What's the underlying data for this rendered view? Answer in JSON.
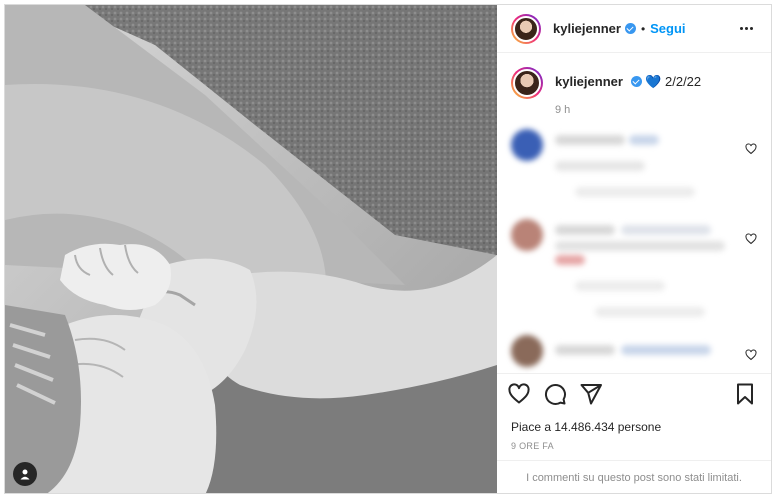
{
  "post": {
    "author": "kyliejenner",
    "follow_label": "Segui",
    "separator": "•",
    "caption_user": "kyliejenner",
    "caption_emoji": "💙",
    "caption_text": "2/2/22",
    "caption_time": "9 h",
    "likes_text": "Piace a 14.486.434 persone",
    "time_ago": "9 ORE FA",
    "comments_limited": "I commenti su questo post sono stati limitati."
  },
  "icons": {
    "verified": "verified-badge-icon",
    "more": "more-options-icon",
    "like": "heart-icon",
    "comment": "comment-icon",
    "share": "send-icon",
    "save": "bookmark-icon",
    "tag": "user-tag-icon"
  },
  "colors": {
    "accent": "#0095f6",
    "text": "#262626",
    "muted": "#8e8e8e",
    "verified": "#3897f0"
  }
}
